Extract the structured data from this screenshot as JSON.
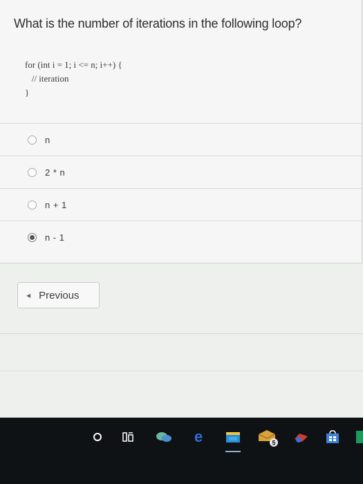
{
  "question": {
    "text": "What is the number of iterations in the following loop?",
    "code_lines": [
      "for (int i = 1; i <= n; i++) {",
      "   // iteration",
      "}"
    ]
  },
  "options": [
    {
      "label": "n",
      "selected": false
    },
    {
      "label": "2 * n",
      "selected": false
    },
    {
      "label": "n + 1",
      "selected": false
    },
    {
      "label": "n - 1",
      "selected": true
    }
  ],
  "navigation": {
    "previous_label": "Previous"
  },
  "taskbar": {
    "icons": [
      "cortana-icon",
      "task-view-icon",
      "chat-icon",
      "edge-icon",
      "file-explorer-icon",
      "mail-icon",
      "steam-icon",
      "store-icon",
      "app-icon"
    ],
    "mail_badge": "5"
  },
  "colors": {
    "background": "#eef0ee",
    "taskbar": "#0f1214",
    "edge_blue": "#2c6fd6"
  }
}
